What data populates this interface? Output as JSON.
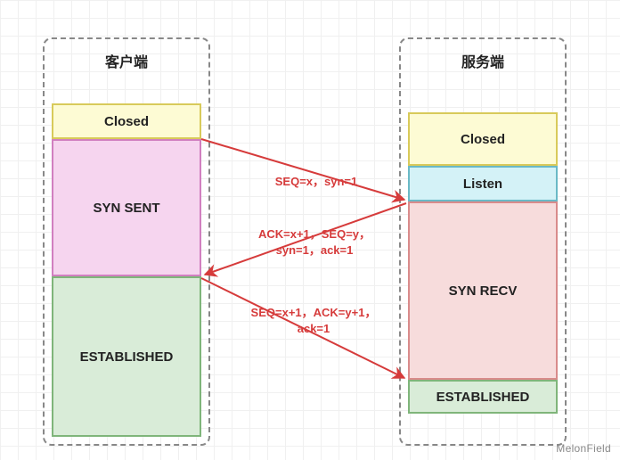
{
  "client": {
    "title": "客户端",
    "states": {
      "closed": "Closed",
      "syn_sent": "SYN SENT",
      "established": "ESTABLISHED"
    }
  },
  "server": {
    "title": "服务端",
    "states": {
      "closed": "Closed",
      "listen": "Listen",
      "syn_recv": "SYN RECV",
      "established": "ESTABLISHED"
    }
  },
  "messages": {
    "m1": "SEQ=x，syn=1",
    "m2": "ACK=x+1，SEQ=y，\nsyn=1，ack=1",
    "m3": "SEQ=x+1，ACK=y+1，\nack=1"
  },
  "watermark": "MelonField"
}
